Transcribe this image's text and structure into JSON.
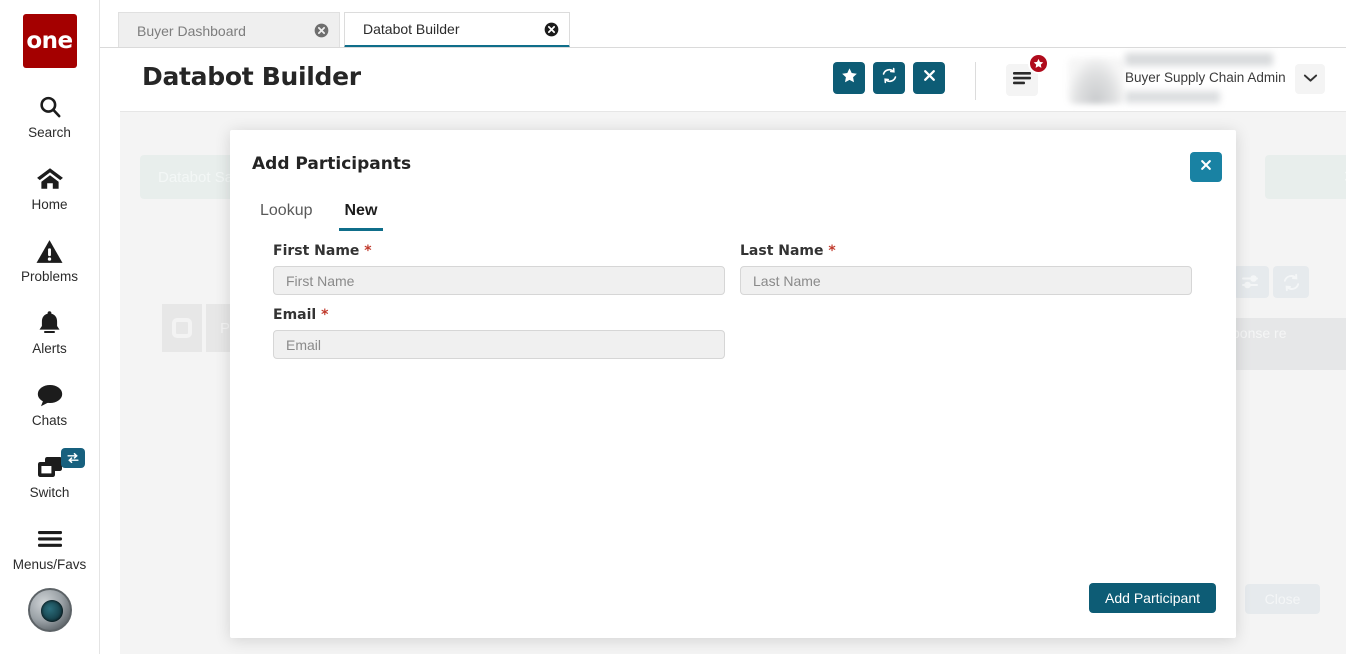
{
  "brand": {
    "logo_text": "one"
  },
  "sidebar": {
    "items": [
      {
        "label": "Search",
        "icon": "search-icon"
      },
      {
        "label": "Home",
        "icon": "home-icon"
      },
      {
        "label": "Problems",
        "icon": "warning-triangle-icon"
      },
      {
        "label": "Alerts",
        "icon": "bell-icon"
      },
      {
        "label": "Chats",
        "icon": "chat-bubble-icon"
      },
      {
        "label": "Switch",
        "icon": "windows-switch-icon",
        "badge_icon": "swap-arrows-icon"
      },
      {
        "label": "Menus/Favs",
        "icon": "hamburger-icon"
      }
    ],
    "avatar_icon": "user-avatar-image"
  },
  "tabs": [
    {
      "title": "Buyer Dashboard",
      "active": false,
      "close_icon": "close-circle-icon"
    },
    {
      "title": "Databot Builder",
      "active": true,
      "close_icon": "close-circle-icon"
    }
  ],
  "header": {
    "title": "Databot Builder",
    "buttons": [
      {
        "name": "favorite",
        "icon": "star-icon"
      },
      {
        "name": "refresh",
        "icon": "refresh-icon"
      },
      {
        "name": "close",
        "icon": "x-icon"
      }
    ],
    "menu_icon": "hamburger-menu-icon",
    "menu_badge_icon": "star-badge-icon",
    "user": {
      "name": "",
      "role": "Buyer Supply Chain Admin",
      "org": ""
    },
    "caret_icon": "chevron-down-icon"
  },
  "background": {
    "save_button_label": "Databot Sav",
    "close_x_label": "×",
    "tile_label": "Part",
    "filter_icon": "sliders-icon",
    "reload_icon": "refresh-icon",
    "response_card_text": "sponse\nre",
    "close_button_label": "Close"
  },
  "modal": {
    "title": "Add Participants",
    "close_icon": "x-icon",
    "tabs": [
      {
        "label": "Lookup",
        "active": false
      },
      {
        "label": "New",
        "active": true
      }
    ],
    "fields": {
      "first_name": {
        "label": "First Name",
        "required_marker": "*",
        "value": "",
        "placeholder": "First Name"
      },
      "last_name": {
        "label": "Last Name",
        "required_marker": "*",
        "value": "",
        "placeholder": "Last Name"
      },
      "email": {
        "label": "Email",
        "required_marker": "*",
        "value": "",
        "placeholder": "Email"
      }
    },
    "submit_label": "Add Participant"
  },
  "colors": {
    "brand_red": "#a40000",
    "teal_dark": "#0d5c75",
    "teal_light": "#1982a3",
    "accent_underline": "#0f6e8a",
    "required_red": "#c0392b",
    "badge_red": "#b00b1c"
  }
}
